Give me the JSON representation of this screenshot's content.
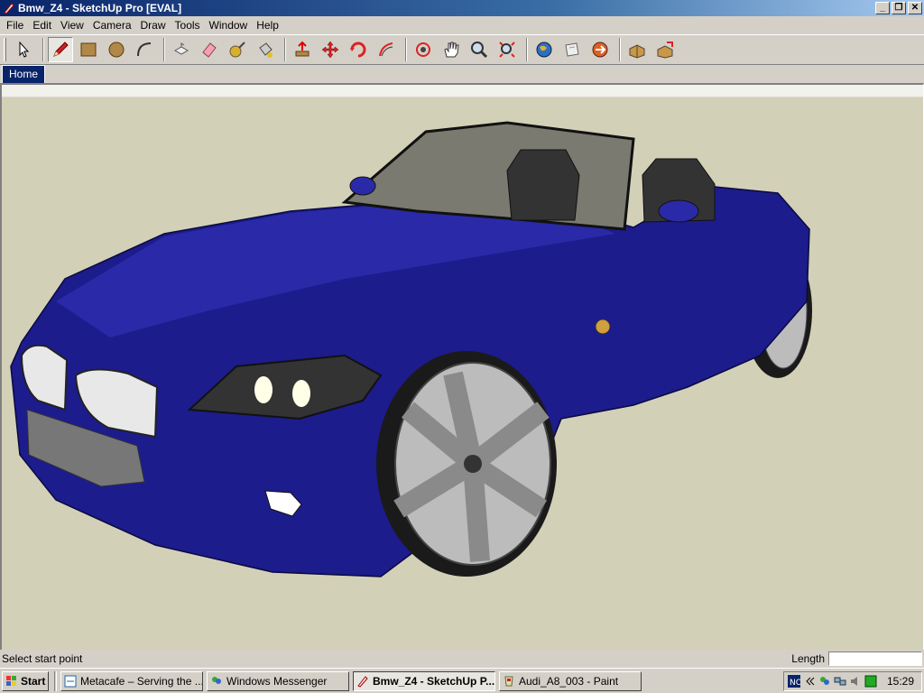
{
  "window": {
    "title": "Bmw_Z4 - SketchUp Pro [EVAL]",
    "buttons": {
      "minimize": "_",
      "maximize": "❐",
      "close": "✕"
    }
  },
  "menu": [
    "File",
    "Edit",
    "View",
    "Camera",
    "Draw",
    "Tools",
    "Window",
    "Help"
  ],
  "toolbar": {
    "tools": [
      {
        "name": "select-tool-icon"
      },
      {
        "name": "pencil-tool-icon",
        "active": true
      },
      {
        "name": "rectangle-tool-icon"
      },
      {
        "name": "circle-tool-icon"
      },
      {
        "name": "arc-tool-icon"
      },
      {
        "name": "make-component-icon"
      },
      {
        "name": "eraser-tool-icon"
      },
      {
        "name": "tape-measure-icon"
      },
      {
        "name": "paint-bucket-icon"
      },
      {
        "name": "push-pull-icon"
      },
      {
        "name": "move-tool-icon"
      },
      {
        "name": "rotate-tool-icon"
      },
      {
        "name": "follow-me-icon"
      },
      {
        "name": "orbit-tool-icon"
      },
      {
        "name": "pan-tool-icon"
      },
      {
        "name": "zoom-tool-icon"
      },
      {
        "name": "zoom-extents-icon"
      },
      {
        "name": "google-earth-icon"
      },
      {
        "name": "get-models-icon"
      },
      {
        "name": "share-model-icon"
      },
      {
        "name": "component-library-icon"
      },
      {
        "name": "share-component-icon"
      }
    ]
  },
  "scene_tabs": [
    "Home"
  ],
  "status": {
    "message": "Select start point",
    "measurement_label": "Length",
    "measurement_value": ""
  },
  "taskbar": {
    "start_label": "Start",
    "tasks": [
      {
        "label": "Metacafe – Serving the ...",
        "icon": "browser-icon",
        "active": false
      },
      {
        "label": "Windows Messenger",
        "icon": "messenger-icon",
        "active": false
      },
      {
        "label": "Bmw_Z4 - SketchUp P...",
        "icon": "sketchup-icon",
        "active": true
      },
      {
        "label": "Audi_A8_003 - Paint",
        "icon": "paint-icon",
        "active": false
      }
    ],
    "clock": "15:29"
  },
  "colors": {
    "title_start": "#0a246a",
    "viewport_ground": "#d3d0b8",
    "car_body": "#1c1c8c"
  }
}
